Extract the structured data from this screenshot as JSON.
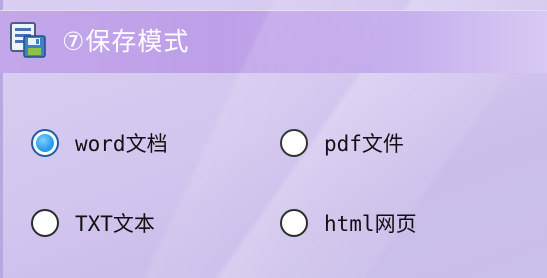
{
  "header": {
    "title": "⑦保存模式",
    "icon": "save-document-icon"
  },
  "save_mode": {
    "selected": "word文档",
    "options": [
      {
        "label": "word文档",
        "checked": true
      },
      {
        "label": "pdf文件",
        "checked": false
      },
      {
        "label": "TXT文本",
        "checked": false
      },
      {
        "label": "html网页",
        "checked": false
      }
    ]
  },
  "colors": {
    "header": "#c4a7ea",
    "panel": "#d3c6ef",
    "title_text": "#ffffff",
    "radio_selected": "#2fa1f1"
  }
}
